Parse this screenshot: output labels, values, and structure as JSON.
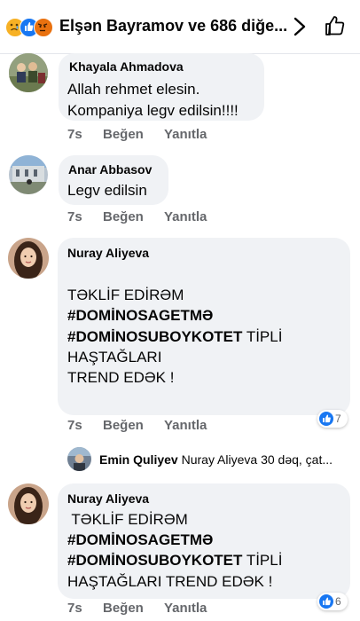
{
  "header": {
    "title": "Elşən Bayramov ve 686 diğe...",
    "reactions": [
      "sad-reaction",
      "like-reaction",
      "angry-reaction"
    ],
    "colors": {
      "like": "#1877f2",
      "sad": "#f7b125",
      "angry": "#e9710f"
    }
  },
  "actions": {
    "like": "Beğen",
    "reply": "Yanıtla"
  },
  "comments": [
    {
      "author": "Khayala Ahmadova",
      "lines": [
        "Allah rehmet elesin.",
        "Kompaniya legv edilsin!!!!"
      ],
      "time": "7s"
    },
    {
      "author": "Anar Abbasov",
      "lines": [
        "Legv edilsin"
      ],
      "time": "7s"
    },
    {
      "author": "Nuray Aliyeva",
      "line1": "TƏKLİF EDİRƏM",
      "tag1": "#DOMİNOSAGETMƏ",
      "tag2": "#DOMİNOSUBOYKOTET",
      "tag2_tail": " TİPLİ",
      "line4": "HAŞTAĞLARI",
      "line5": "TREND EDƏK !",
      "time": "7s",
      "reaction_count": "7",
      "reply_preview": {
        "author": "Emin Quliyev",
        "text": " Nuray Aliyeva 30 dəq, çat..."
      }
    },
    {
      "author": "Nuray Aliyeva",
      "line1": " TƏKLİF EDİRƏM",
      "tag1": "#DOMİNOSAGETMƏ",
      "tag2": "#DOMİNOSUBOYKOTET",
      "tag2_tail": " TİPLİ",
      "line4": "HAŞTAĞLARI TREND EDƏK !",
      "time": "7s",
      "reaction_count": "6"
    }
  ]
}
